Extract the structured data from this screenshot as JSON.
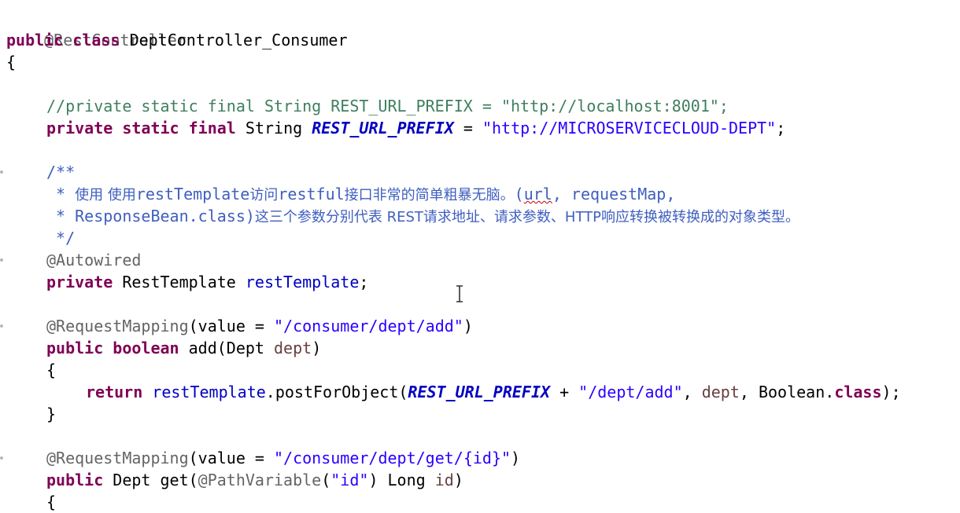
{
  "editor": {
    "lines": {
      "l1": {
        "ann": "@RestController"
      },
      "l2": {
        "kw1": "public",
        "kw2": "class",
        "name": "DeptController_Consumer"
      },
      "l3": {
        "brace": "{"
      },
      "l5": {
        "comment": "//private static final String REST_URL_PREFIX = \"http://localhost:8001\";"
      },
      "l6": {
        "kw1": "private",
        "kw2": "static",
        "kw3": "final",
        "type": "String",
        "field": "REST_URL_PREFIX",
        "eq": " = ",
        "value": "\"http://MICROSERVICECLOUD-DEPT\"",
        "semi": ";"
      },
      "l8": {
        "doc_open": "/**"
      },
      "l9": {
        "star": " * ",
        "text_cn": "使用 使用",
        "t2": "restTemplate",
        "text_cn2": "访问",
        "t3": "restful",
        "text_cn3": "接口非常的简单粗暴无脑。",
        "paren": "(",
        "url": "url",
        "rest": ", requestMap,"
      },
      "l10": {
        "star": " * ",
        "t1": "ResponseBean.class)",
        "text_cn": "这三个参数分别代表 REST请求地址、请求参数、HTTP响应转换被转换成的对象类型。"
      },
      "l11": {
        "doc_close": " */"
      },
      "l12": {
        "ann": "@Autowired"
      },
      "l13": {
        "kw1": "private",
        "type": "RestTemplate",
        "field": "restTemplate",
        "semi": ";"
      },
      "l15": {
        "ann": "@RequestMapping",
        "open": "(value = ",
        "str": "\"/consumer/dept/add\"",
        "close": ")"
      },
      "l16": {
        "kw1": "public",
        "kw2": "boolean",
        "method": "add(Dept ",
        "param": "dept",
        "close": ")"
      },
      "l17": {
        "brace": "{"
      },
      "l18": {
        "kw1": "return",
        "field": "restTemplate",
        "call": ".postForObject(",
        "sfield": "REST_URL_PREFIX",
        "plus": " + ",
        "str": "\"/dept/add\"",
        "comma": ", ",
        "param": "dept",
        "tail": ", Boolean.",
        "kw2": "class",
        "end": ");"
      },
      "l19": {
        "brace": "}"
      },
      "l21": {
        "ann": "@RequestMapping",
        "open": "(value = ",
        "str": "\"/consumer/dept/get/{id}\"",
        "close": ")"
      },
      "l22": {
        "kw1": "public",
        "type": "Dept get(",
        "ann": "@PathVariable",
        "open": "(",
        "str": "\"id\"",
        "mid": ") Long ",
        "param": "id",
        "close": ")"
      },
      "l23": {
        "brace": "{"
      }
    }
  }
}
